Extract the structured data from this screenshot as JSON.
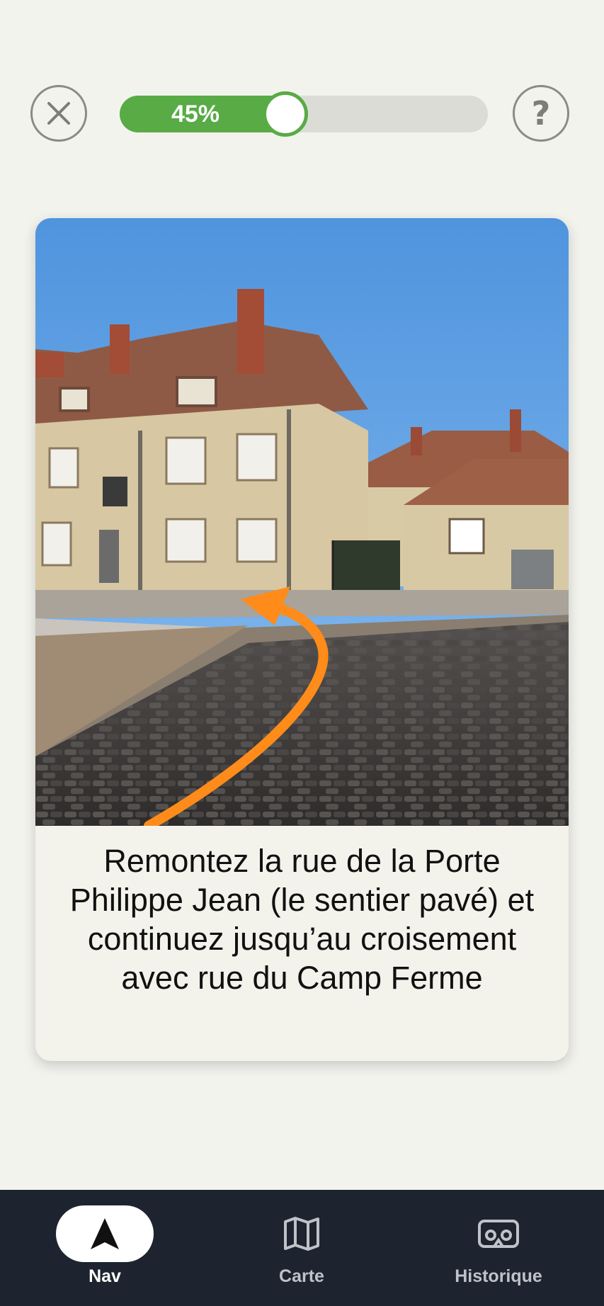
{
  "top_bar": {
    "close_icon": "close-x-icon",
    "help_icon": "question-mark-icon",
    "help_glyph": "?",
    "progress": {
      "value": 0.45,
      "label": "45%"
    }
  },
  "card": {
    "photo": "street photo: cobblestone lane with old French houses under blue sky, orange curved arrow indicating direction",
    "instruction": "Remontez la rue de la Porte Philippe Jean (le sentier pavé) et continuez jusqu’au croisement avec rue du Camp Ferme"
  },
  "bottom_nav": {
    "items": [
      {
        "label": "Nav",
        "icon": "navigation-arrow-icon",
        "active": true
      },
      {
        "label": "Carte",
        "icon": "map-icon",
        "active": false
      },
      {
        "label": "Historique",
        "icon": "vr-headset-icon",
        "active": false
      }
    ]
  },
  "colors": {
    "background": "#f3f3ee",
    "progress_green": "#58ab45",
    "progress_track": "#dcdcd7",
    "nav_background": "#1d2430",
    "arrow_orange": "#ff8c1a"
  }
}
